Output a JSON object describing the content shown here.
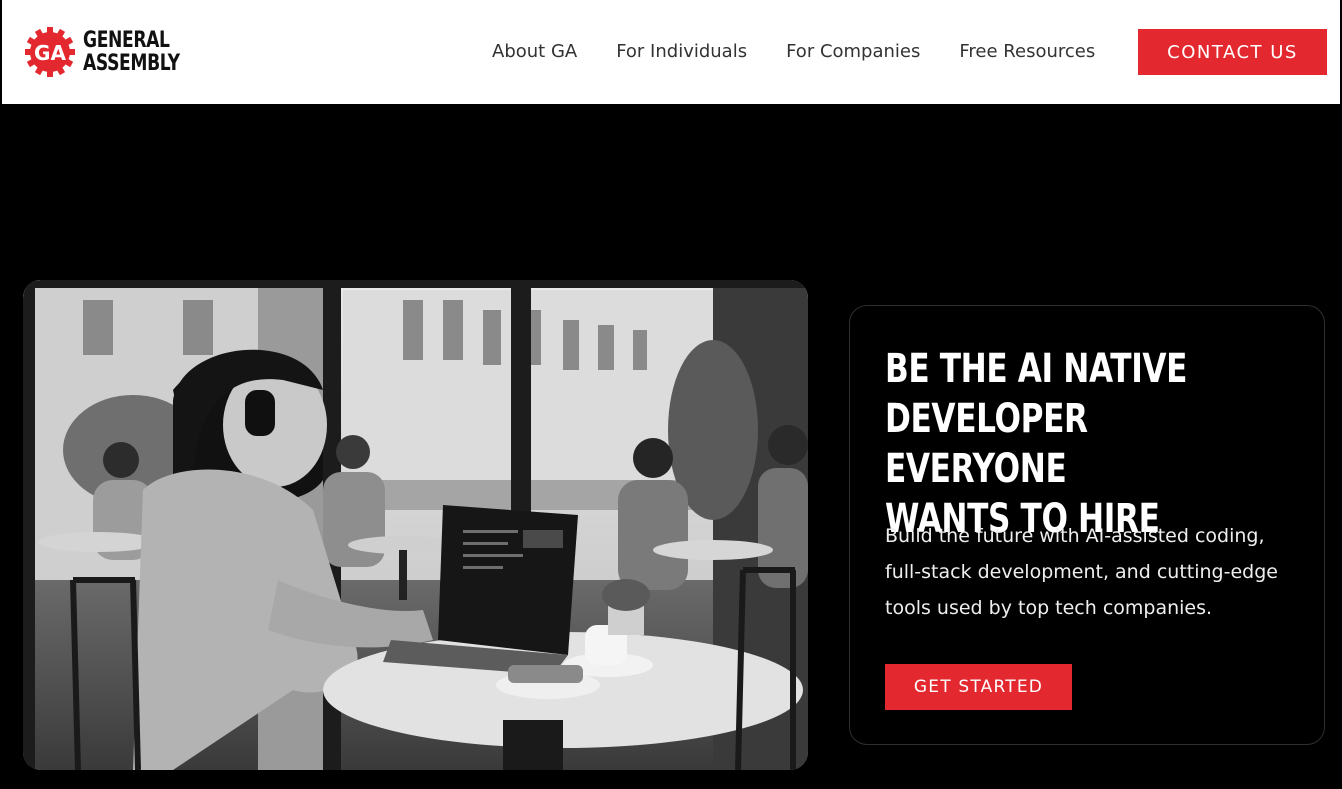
{
  "brand": {
    "logo_mark": "GA",
    "name_line1": "GENERAL",
    "name_line2": "ASSEMBLY",
    "accent_color": "#e3282f"
  },
  "nav": {
    "items": [
      {
        "label": "About GA"
      },
      {
        "label": "For Individuals"
      },
      {
        "label": "For Companies"
      },
      {
        "label": "Free Resources"
      }
    ],
    "contact_label": "CONTACT US"
  },
  "hero": {
    "title": "BE THE AI NATIVE\nDEVELOPER EVERYONE\nWANTS TO HIRE",
    "description": "Build the future with AI-assisted coding, full-stack development, and cutting-edge tools used by top tech companies.",
    "cta_label": "GET STARTED"
  }
}
